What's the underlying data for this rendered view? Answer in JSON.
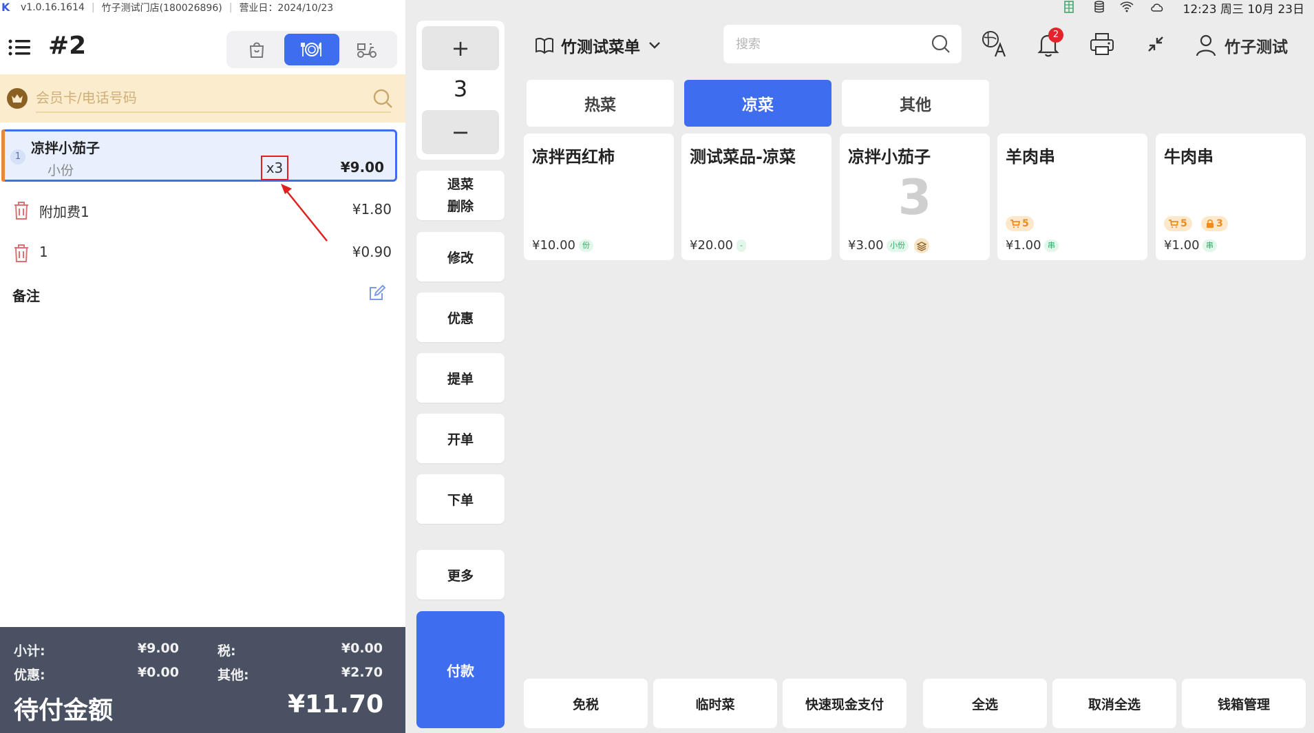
{
  "app": {
    "version": "v1.0.16.1614",
    "store": "竹子测试门店(180026896)",
    "business_day": "营业日：2024/10/23"
  },
  "order": {
    "number": "#2",
    "mode_active": "dine-in"
  },
  "member": {
    "placeholder": "会员卡/电话号码"
  },
  "item": {
    "index": "1",
    "name": "凉拌小茄子",
    "spec": "小份",
    "quantity": "x3",
    "price": "¥9.00"
  },
  "fees": [
    {
      "name": "附加费1",
      "price": "¥1.80"
    },
    {
      "name": "1",
      "price": "¥0.90"
    }
  ],
  "remark_label": "备注",
  "summary": {
    "subtotal_label": "小计:",
    "subtotal": "¥9.00",
    "tax_label": "税:",
    "tax": "¥0.00",
    "discount_label": "优惠:",
    "discount": "¥0.00",
    "other_label": "其他:",
    "other": "¥2.70",
    "due_label": "待付金额",
    "due": "¥11.70"
  },
  "quantity_panel": {
    "plus": "+",
    "value": "3",
    "minus": "−"
  },
  "actions": {
    "refund_line1": "退菜",
    "refund_line2": "删除",
    "modify": "修改",
    "discount": "优惠",
    "pickup": "提单",
    "open": "开单",
    "place": "下单",
    "more": "更多",
    "pay": "付款"
  },
  "status_bar": {
    "time": "12:23 周三 10月 23日"
  },
  "header": {
    "menu_title": "竹测试菜单",
    "search_placeholder": "搜索",
    "notification_count": "2",
    "user_name": "竹子测试"
  },
  "categories": [
    {
      "label": "热菜",
      "active": false
    },
    {
      "label": "凉菜",
      "active": true
    },
    {
      "label": "其他",
      "active": false
    }
  ],
  "dishes": [
    {
      "name": "凉拌西红柿",
      "price": "¥10.00",
      "tag": "份"
    },
    {
      "name": "测试菜品-凉菜",
      "price": "¥20.00",
      "tag": "-"
    },
    {
      "name": "凉拌小茄子",
      "big": "3",
      "price": "¥3.00",
      "tag": "小份"
    },
    {
      "name": "羊肉串",
      "price": "¥1.00",
      "tag": "串",
      "cart_badge": "5"
    },
    {
      "name": "牛肉串",
      "price": "¥1.00",
      "tag": "串",
      "cart_badge": "5",
      "lock_badge": "3"
    }
  ],
  "bottom_actions": [
    "免税",
    "临时菜",
    "快速现金支付",
    "全选",
    "取消全选",
    "钱箱管理"
  ],
  "colors": {
    "accent": "#3f6df0",
    "member_bar": "#fbecce",
    "summary_bg": "#4a5163",
    "highlight_red": "#e02020"
  }
}
